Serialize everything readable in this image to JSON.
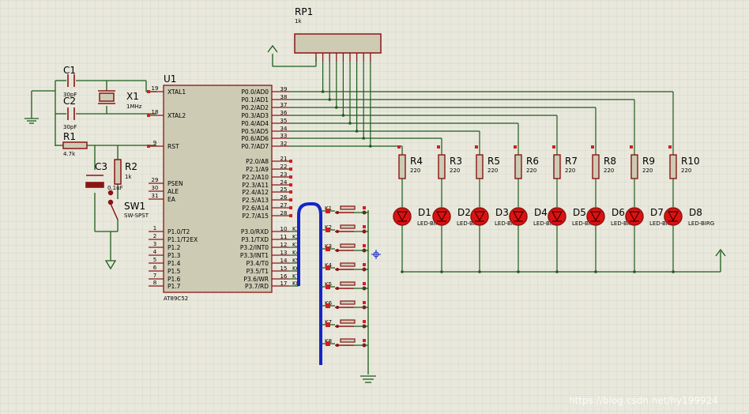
{
  "watermark": "https://blog.csdn.net/hy199924",
  "colors": {
    "wire": "#1a5c1a",
    "component": "#8a1414",
    "chip_fill": "#cdcbb4",
    "led_fill": "#dd1111",
    "bus": "#1525c8",
    "background": "#e9e8dc"
  },
  "mcu": {
    "ref": "U1",
    "part": "AT89C52",
    "left_pins": [
      {
        "name": "XTAL1",
        "num": "19"
      },
      {
        "name": "XTAL2",
        "num": "18"
      },
      {
        "name": "RST",
        "num": "9"
      },
      {
        "name": "PSEN",
        "num": "29"
      },
      {
        "name": "ALE",
        "num": "30"
      },
      {
        "name": "EA",
        "num": "31"
      },
      {
        "name": "P1.0/T2",
        "num": "1"
      },
      {
        "name": "P1.1/T2EX",
        "num": "2"
      },
      {
        "name": "P1.2",
        "num": "3"
      },
      {
        "name": "P1.3",
        "num": "4"
      },
      {
        "name": "P1.4",
        "num": "5"
      },
      {
        "name": "P1.5",
        "num": "6"
      },
      {
        "name": "P1.6",
        "num": "7"
      },
      {
        "name": "P1.7",
        "num": "8"
      }
    ],
    "right_pins": [
      {
        "name": "P0.0/AD0",
        "num": "39"
      },
      {
        "name": "P0.1/AD1",
        "num": "38"
      },
      {
        "name": "P0.2/AD2",
        "num": "37"
      },
      {
        "name": "P0.3/AD3",
        "num": "36"
      },
      {
        "name": "P0.4/AD4",
        "num": "35"
      },
      {
        "name": "P0.5/AD5",
        "num": "34"
      },
      {
        "name": "P0.6/AD6",
        "num": "33"
      },
      {
        "name": "P0.7/AD7",
        "num": "32"
      },
      {
        "name": "P2.0/A8",
        "num": "21"
      },
      {
        "name": "P2.1/A9",
        "num": "22"
      },
      {
        "name": "P2.2/A10",
        "num": "23"
      },
      {
        "name": "P2.3/A11",
        "num": "24"
      },
      {
        "name": "P2.4/A12",
        "num": "25"
      },
      {
        "name": "P2.5/A13",
        "num": "26"
      },
      {
        "name": "P2.6/A14",
        "num": "27"
      },
      {
        "name": "P2.7/A15",
        "num": "28"
      },
      {
        "name": "P3.0/RXD",
        "num": "10",
        "net": "K1"
      },
      {
        "name": "P3.1/TXD",
        "num": "11",
        "net": "K2"
      },
      {
        "name": "P3.2/INT0",
        "num": "12",
        "net": "K3"
      },
      {
        "name": "P3.3/INT1",
        "num": "13",
        "net": "K4"
      },
      {
        "name": "P3.4/T0",
        "num": "14",
        "net": "K5"
      },
      {
        "name": "P3.5/T1",
        "num": "15",
        "net": "K6"
      },
      {
        "name": "P3.6/WR",
        "num": "16",
        "net": "K7"
      },
      {
        "name": "P3.7/RD",
        "num": "17",
        "net": "K8"
      }
    ]
  },
  "passives": {
    "c1": {
      "ref": "C1",
      "value": "30pF"
    },
    "c2": {
      "ref": "C2",
      "value": "30pF"
    },
    "x1": {
      "ref": "X1",
      "value": "1MHz"
    },
    "r1": {
      "ref": "R1",
      "value": "4.7k"
    },
    "c3": {
      "ref": "C3",
      "value": "0.1uF"
    },
    "r2": {
      "ref": "R2",
      "value": "1k"
    },
    "sw1": {
      "ref": "SW1",
      "value": "SW-SPST"
    },
    "rp1": {
      "ref": "RP1",
      "value": "1k"
    }
  },
  "led_resistors": [
    {
      "ref": "R4",
      "value": "220"
    },
    {
      "ref": "R3",
      "value": "220"
    },
    {
      "ref": "R5",
      "value": "220"
    },
    {
      "ref": "R6",
      "value": "220"
    },
    {
      "ref": "R7",
      "value": "220"
    },
    {
      "ref": "R8",
      "value": "220"
    },
    {
      "ref": "R9",
      "value": "220"
    },
    {
      "ref": "R10",
      "value": "220"
    }
  ],
  "leds": [
    {
      "ref": "D1",
      "value": "LED-BIRG"
    },
    {
      "ref": "D2",
      "value": "LED-BIRG"
    },
    {
      "ref": "D3",
      "value": "LED-BIRG"
    },
    {
      "ref": "D4",
      "value": "LED-BIRG"
    },
    {
      "ref": "D5",
      "value": "LED-BIRG"
    },
    {
      "ref": "D6",
      "value": "LED-BIRG"
    },
    {
      "ref": "D7",
      "value": "LED-BIRG"
    },
    {
      "ref": "D8",
      "value": "LED-BIRG"
    }
  ],
  "keys": [
    {
      "net": "K1"
    },
    {
      "net": "K2"
    },
    {
      "net": "K3"
    },
    {
      "net": "K4"
    },
    {
      "net": "K5"
    },
    {
      "net": "K6"
    },
    {
      "net": "K7"
    },
    {
      "net": "K8"
    }
  ]
}
